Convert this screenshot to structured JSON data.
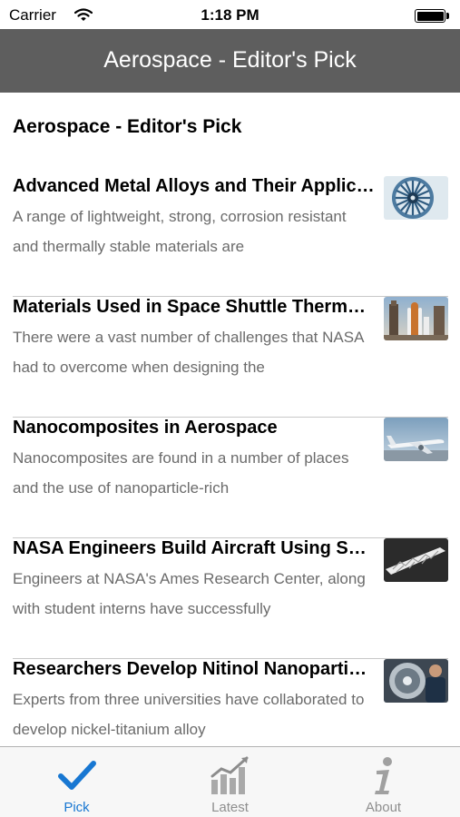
{
  "status_bar": {
    "carrier": "Carrier",
    "time": "1:18 PM"
  },
  "nav_bar": {
    "title": "Aerospace - Editor's Pick"
  },
  "content": {
    "heading": "Aerospace - Editor's Pick",
    "articles": [
      {
        "title": "Advanced Metal Alloys and Their Applications",
        "snippet": "A range of lightweight, strong, corrosion resistant and thermally stable materials are",
        "thumbnail_icon": "jet-engine-thumbnail"
      },
      {
        "title": "Materials Used in Space Shuttle Thermal Protection",
        "snippet": "There were a vast number of challenges that NASA had to overcome when designing the",
        "thumbnail_icon": "space-shuttle-thumbnail"
      },
      {
        "title": "Nanocomposites in Aerospace",
        "snippet": "Nanocomposites are found in a number of places and the use of nanoparticle-rich",
        "thumbnail_icon": "airplane-thumbnail"
      },
      {
        "title": "NASA Engineers Build Aircraft Using Shape-Memory Alloys",
        "snippet": "Engineers at NASA's Ames Research Center, along with student interns have successfully",
        "thumbnail_icon": "aircraft-part-thumbnail"
      },
      {
        "title": "Researchers Develop Nitinol Nanoparticles",
        "snippet": "Experts from three universities have collaborated to develop nickel-titanium alloy",
        "thumbnail_icon": "engine-technician-thumbnail"
      }
    ]
  },
  "tab_bar": {
    "tabs": [
      {
        "label": "Pick",
        "icon": "checkmark-icon",
        "active": true
      },
      {
        "label": "Latest",
        "icon": "bar-chart-icon",
        "active": false
      },
      {
        "label": "About",
        "icon": "info-icon",
        "active": false
      }
    ]
  },
  "colors": {
    "nav_background": "#5e5e5e",
    "active_tab": "#1877d2",
    "inactive_tab": "#8e8e8e",
    "snippet_text": "#6b6b6b"
  }
}
